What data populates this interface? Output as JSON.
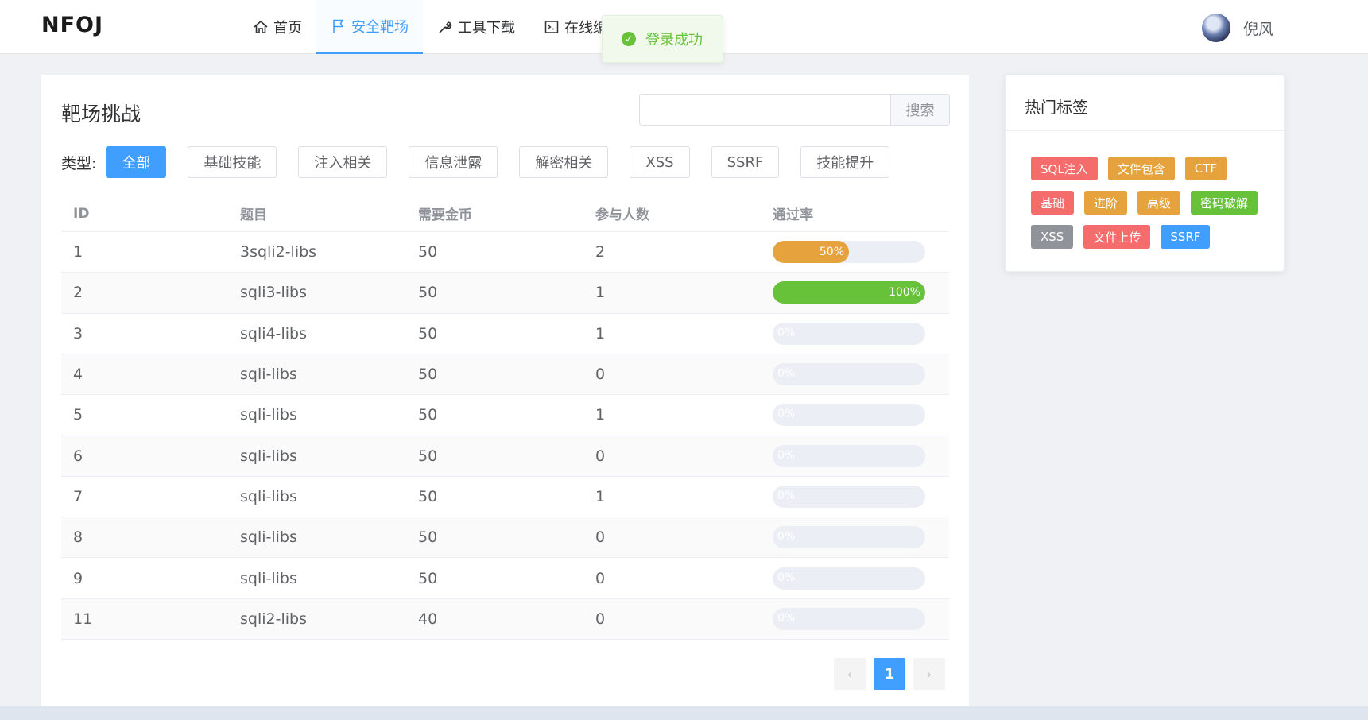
{
  "header": {
    "logo": "NFOJ",
    "nav": [
      {
        "label": "首页",
        "icon": "home-icon",
        "active": false
      },
      {
        "label": "安全靶场",
        "icon": "flag-icon",
        "active": true
      },
      {
        "label": "工具下载",
        "icon": "wrench-icon",
        "active": false
      },
      {
        "label": "在线编",
        "icon": "terminal-icon",
        "active": false
      }
    ],
    "user_name": "倪风"
  },
  "toast": {
    "message": "登录成功",
    "type": "success"
  },
  "main": {
    "title": "靶场挑战",
    "search": {
      "value": "",
      "placeholder": "",
      "button": "搜索"
    },
    "type_label": "类型:",
    "types": [
      "全部",
      "基础技能",
      "注入相关",
      "信息泄露",
      "解密相关",
      "XSS",
      "SSRF",
      "技能提升"
    ],
    "active_type": "全部",
    "columns": [
      "ID",
      "题目",
      "需要金币",
      "参与人数",
      "通过率"
    ],
    "rows": [
      {
        "id": "1",
        "title": "3sqli2-libs",
        "coins": "50",
        "participants": "2",
        "rate": 50,
        "rate_label": "50%"
      },
      {
        "id": "2",
        "title": "sqli3-libs",
        "coins": "50",
        "participants": "1",
        "rate": 100,
        "rate_label": "100%"
      },
      {
        "id": "3",
        "title": "sqli4-libs",
        "coins": "50",
        "participants": "1",
        "rate": 0,
        "rate_label": "0%"
      },
      {
        "id": "4",
        "title": "sqli-libs",
        "coins": "50",
        "participants": "0",
        "rate": 0,
        "rate_label": "0%"
      },
      {
        "id": "5",
        "title": "sqli-libs",
        "coins": "50",
        "participants": "1",
        "rate": 0,
        "rate_label": "0%"
      },
      {
        "id": "6",
        "title": "sqli-libs",
        "coins": "50",
        "participants": "0",
        "rate": 0,
        "rate_label": "0%"
      },
      {
        "id": "7",
        "title": "sqli-libs",
        "coins": "50",
        "participants": "1",
        "rate": 0,
        "rate_label": "0%"
      },
      {
        "id": "8",
        "title": "sqli-libs",
        "coins": "50",
        "participants": "0",
        "rate": 0,
        "rate_label": "0%"
      },
      {
        "id": "9",
        "title": "sqli-libs",
        "coins": "50",
        "participants": "0",
        "rate": 0,
        "rate_label": "0%"
      },
      {
        "id": "11",
        "title": "sqli2-libs",
        "coins": "40",
        "participants": "0",
        "rate": 0,
        "rate_label": "0%"
      }
    ],
    "pagination": {
      "prev": "‹",
      "current": "1",
      "next": "›"
    }
  },
  "sidebar": {
    "title": "热门标签",
    "tags": [
      {
        "label": "SQL注入",
        "color": "#f56c6c"
      },
      {
        "label": "文件包含",
        "color": "#e6a23c"
      },
      {
        "label": "CTF",
        "color": "#e6a23c"
      },
      {
        "label": "基础",
        "color": "#f56c6c"
      },
      {
        "label": "进阶",
        "color": "#e6a23c"
      },
      {
        "label": "高级",
        "color": "#e6a23c"
      },
      {
        "label": "密码破解",
        "color": "#67c23a"
      },
      {
        "label": "XSS",
        "color": "#909399"
      },
      {
        "label": "文件上传",
        "color": "#f56c6c"
      },
      {
        "label": "SSRF",
        "color": "#409eff"
      }
    ]
  },
  "colors": {
    "accent": "#409eff",
    "success": "#67c23a",
    "warning": "#e6a23c",
    "danger": "#f56c6c"
  }
}
